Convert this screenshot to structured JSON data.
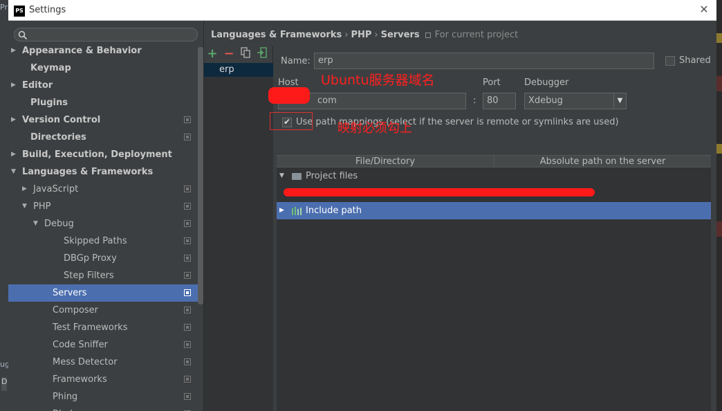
{
  "window": {
    "app_icon": "PS",
    "title": "Settings",
    "close": "✕"
  },
  "background": {
    "left_top_text": "Pr",
    "left_bottom_text": "ug",
    "left_bottom_badge": "D"
  },
  "sidebar": {
    "search_placeholder": "",
    "items": [
      {
        "label": "Appearance & Behavior",
        "arrow": "▶",
        "bold": true
      },
      {
        "label": "Keymap",
        "bold": true
      },
      {
        "label": "Editor",
        "arrow": "▶",
        "bold": true
      },
      {
        "label": "Plugins",
        "bold": true
      },
      {
        "label": "Version Control",
        "arrow": "▶",
        "bold": true
      },
      {
        "label": "Directories",
        "bold": true
      },
      {
        "label": "Build, Execution, Deployment",
        "arrow": "▶",
        "bold": true
      },
      {
        "label": "Languages & Frameworks",
        "arrow": "▼",
        "bold": true
      },
      {
        "label": "JavaScript",
        "arrow": "▶"
      },
      {
        "label": "PHP",
        "arrow": "▼"
      },
      {
        "label": "Debug",
        "arrow": "▼"
      },
      {
        "label": "Skipped Paths"
      },
      {
        "label": "DBGp Proxy"
      },
      {
        "label": "Step Filters"
      },
      {
        "label": "Servers",
        "selected": true
      },
      {
        "label": "Composer"
      },
      {
        "label": "Test Frameworks"
      },
      {
        "label": "Code Sniffer"
      },
      {
        "label": "Mess Detector"
      },
      {
        "label": "Frameworks"
      },
      {
        "label": "Phing"
      },
      {
        "label": "Blade"
      }
    ]
  },
  "breadcrumb": {
    "parts": [
      "Languages & Frameworks",
      "PHP",
      "Servers"
    ],
    "separator": "›",
    "scope": "For current project"
  },
  "servers": {
    "add": "+",
    "remove": "−",
    "items": [
      "erp"
    ]
  },
  "form": {
    "name_label": "Name:",
    "name_value": "erp",
    "shared_label": "Shared",
    "host_label": "Host",
    "host_value": "com",
    "host_prefix_dot": ".",
    "port_label": "Port",
    "port_sep": ":",
    "port_value": "80",
    "debugger_label": "Debugger",
    "debugger_value": "Xdebug",
    "use_mappings_label": "Use path mappings (select if the server is remote or symlinks are used)"
  },
  "annotations": {
    "host_note": "Ubuntu服务器域名",
    "mapping_note": "映射必须勾上",
    "color": "#ff2020"
  },
  "table": {
    "col1": "File/Directory",
    "col2": "Absolute path on the server",
    "rows": [
      {
        "label": "Project files",
        "arrow": "▼"
      },
      {
        "label": "Include path",
        "arrow": "▶",
        "selected": true
      }
    ]
  },
  "colors": {
    "selection": "#4b6eaf",
    "panel": "#3c3f41",
    "add_green": "#59a869",
    "remove_red": "#e05555"
  }
}
